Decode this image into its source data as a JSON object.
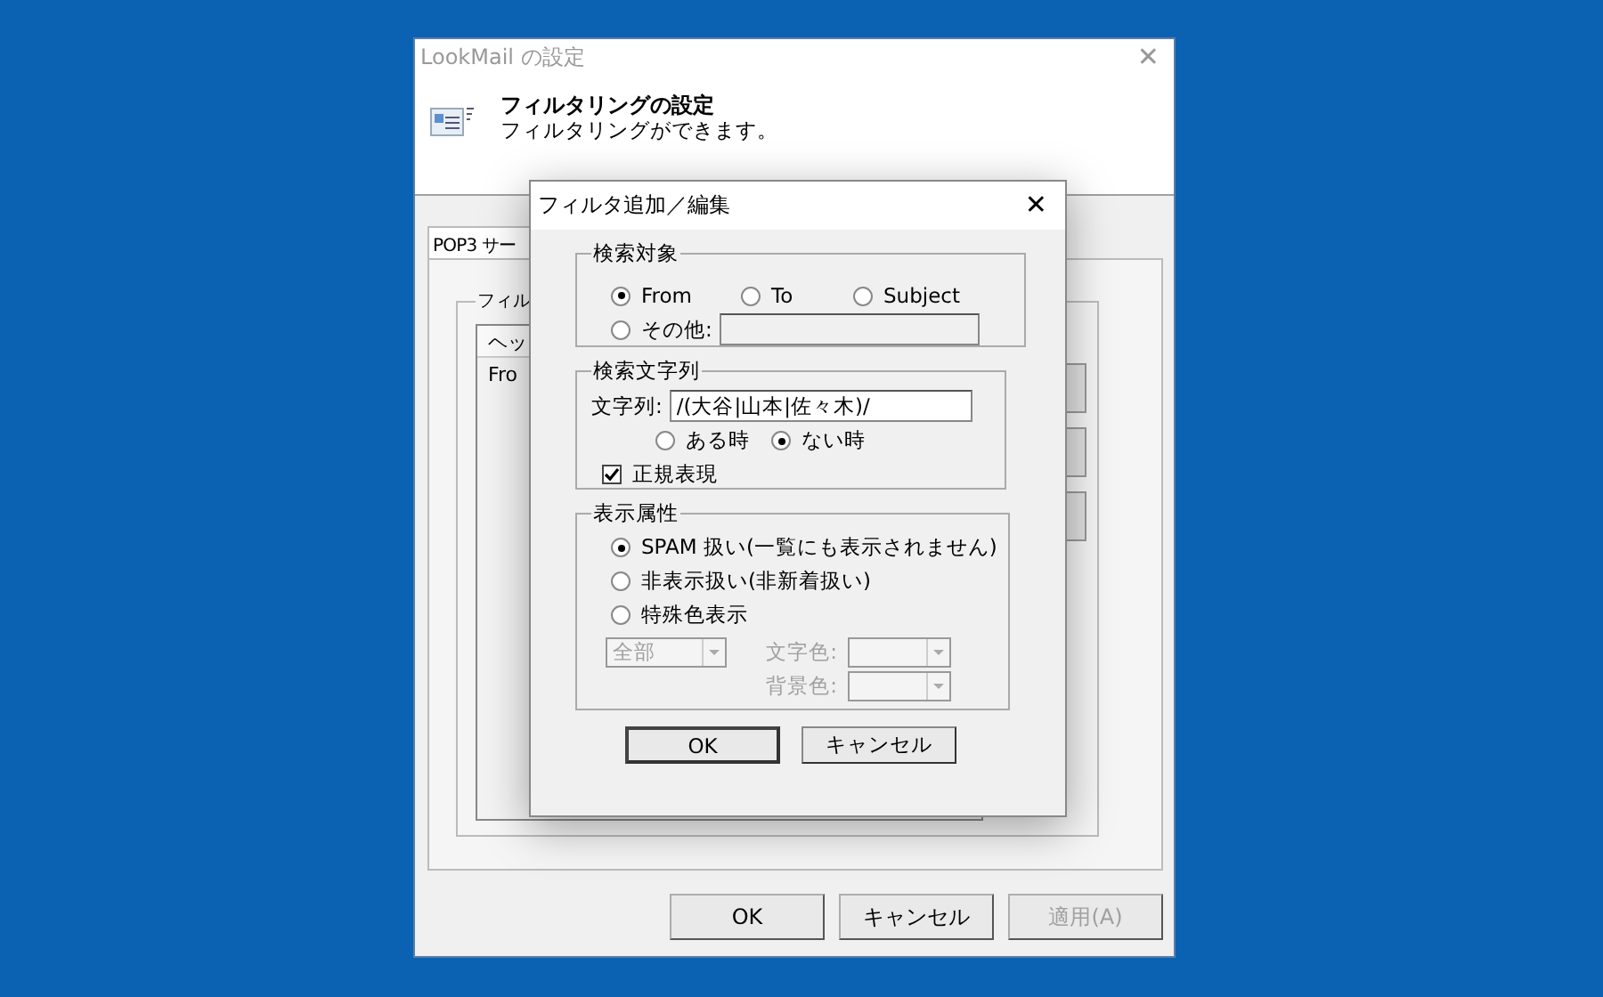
{
  "window": {
    "title": "LookMail の設定",
    "close": "✕"
  },
  "header": {
    "title": "フィルタリングの設定",
    "subtitle": "フィルタリングができます。"
  },
  "tab": {
    "label": "POP3 サー",
    "selected": true
  },
  "filter_group": {
    "label": "フィル",
    "list": {
      "column": "ヘッ",
      "rows": [
        "Fro"
      ]
    }
  },
  "buttons": [
    {
      "label": "OK",
      "disabled": false
    },
    {
      "label": "キャンセル",
      "disabled": false
    },
    {
      "label": "適用(A)",
      "disabled": true
    }
  ],
  "dialog": {
    "title": "フィルタ追加／編集",
    "close": "✕",
    "target": {
      "label": "検索対象",
      "options": [
        {
          "label": "From",
          "selected": true
        },
        {
          "label": "To",
          "selected": false
        },
        {
          "label": "Subject",
          "selected": false
        }
      ],
      "other": {
        "label": "その他:",
        "selected": false
      }
    },
    "search": {
      "label": "検索文字列",
      "field_label": "文字列:",
      "value": "/(大谷|山本|佐々木)/",
      "match": [
        {
          "label": "ある時",
          "selected": false
        },
        {
          "label": "ない時",
          "selected": true
        }
      ],
      "regex": {
        "label": "正規表現",
        "checked": true
      }
    },
    "display": {
      "label": "表示属性",
      "options": [
        {
          "label": "SPAM 扱い(一覧にも表示されません)",
          "selected": true
        },
        {
          "label": "非表示扱い(非新着扱い)",
          "selected": false
        },
        {
          "label": "特殊色表示",
          "selected": false
        }
      ],
      "scope": {
        "value": "全部",
        "disabled": true
      },
      "text_color": {
        "label": "文字色:",
        "disabled": true
      },
      "bg_color": {
        "label": "背景色:",
        "disabled": true
      }
    },
    "buttons": [
      {
        "label": "OK",
        "default": true
      },
      {
        "label": "キャンセル",
        "default": false
      }
    ]
  }
}
